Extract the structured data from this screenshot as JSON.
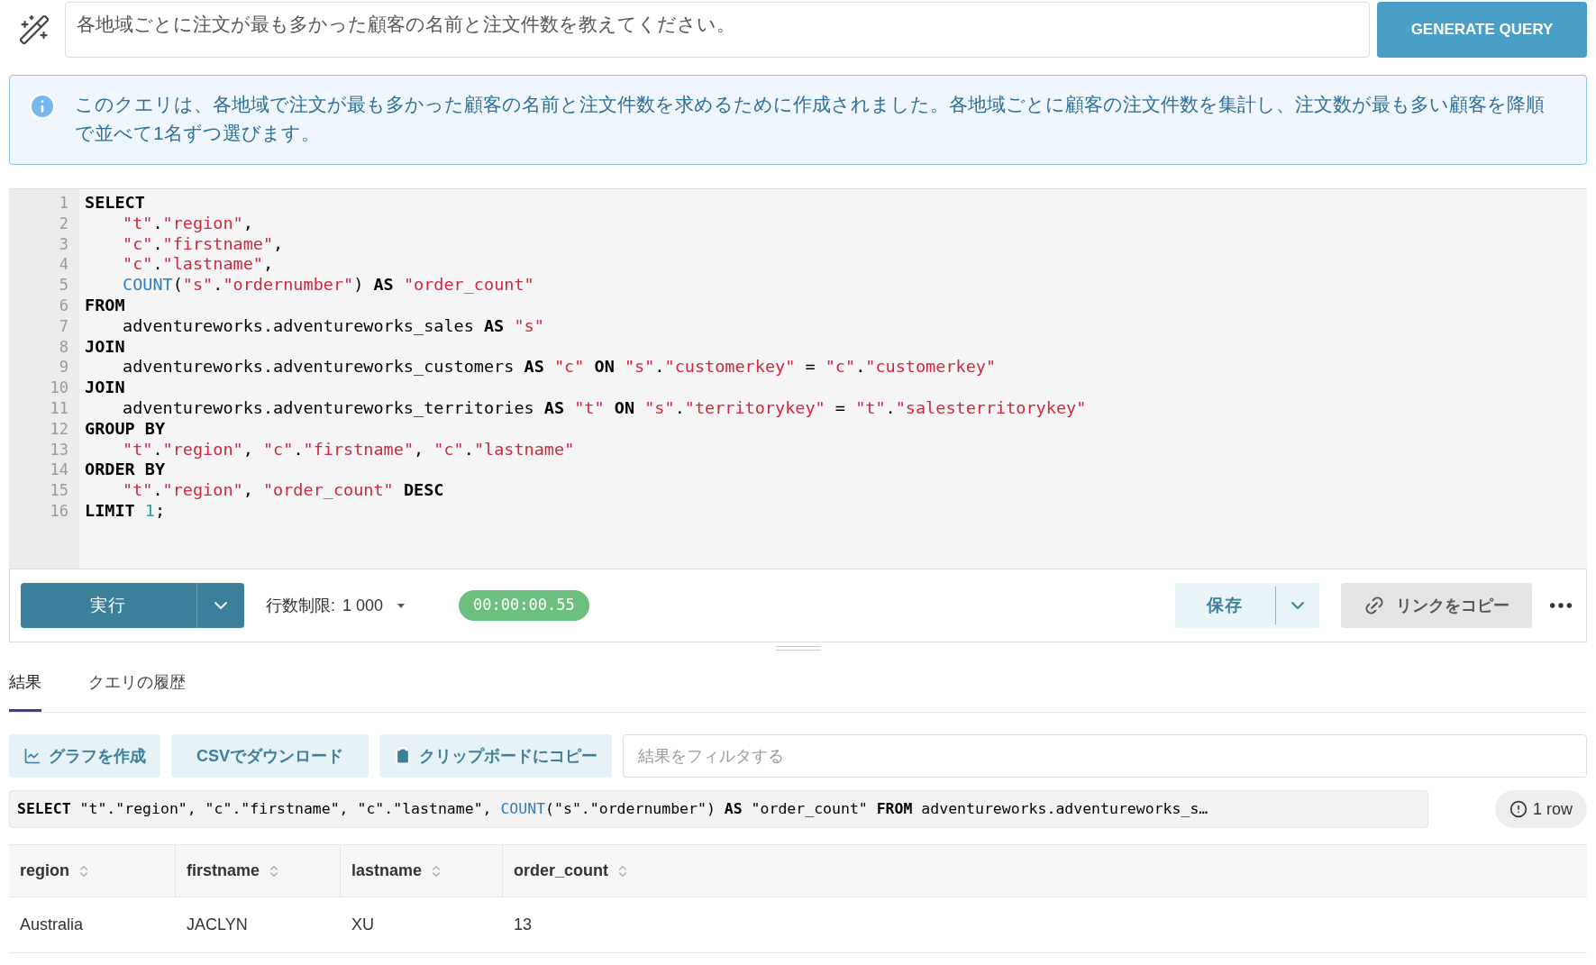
{
  "prompt": {
    "value": "各地域ごとに注文が最も多かった顧客の名前と注文件数を教えてください。",
    "button": "GENERATE QUERY"
  },
  "info": "このクエリは、各地域で注文が最も多かった顧客の名前と注文件数を求めるために作成されました。各地域ごとに顧客の注文件数を集計し、注文数が最も多い顧客を降順で並べて1名ずつ選びます。",
  "editor": {
    "lines": [
      {
        "number": "1",
        "indent": false,
        "tokens": [
          {
            "kind": "kw",
            "text": "SELECT"
          }
        ]
      },
      {
        "number": "2",
        "indent": true,
        "tokens": [
          {
            "kind": "str",
            "text": "\"t\""
          },
          {
            "kind": "plain",
            "text": "."
          },
          {
            "kind": "str",
            "text": "\"region\""
          },
          {
            "kind": "plain",
            "text": ","
          }
        ]
      },
      {
        "number": "3",
        "indent": true,
        "tokens": [
          {
            "kind": "str",
            "text": "\"c\""
          },
          {
            "kind": "plain",
            "text": "."
          },
          {
            "kind": "str",
            "text": "\"firstname\""
          },
          {
            "kind": "plain",
            "text": ","
          }
        ]
      },
      {
        "number": "4",
        "indent": true,
        "tokens": [
          {
            "kind": "str",
            "text": "\"c\""
          },
          {
            "kind": "plain",
            "text": "."
          },
          {
            "kind": "str",
            "text": "\"lastname\""
          },
          {
            "kind": "plain",
            "text": ","
          }
        ]
      },
      {
        "number": "5",
        "indent": true,
        "tokens": [
          {
            "kind": "fn",
            "text": "COUNT"
          },
          {
            "kind": "plain",
            "text": "("
          },
          {
            "kind": "str",
            "text": "\"s\""
          },
          {
            "kind": "plain",
            "text": "."
          },
          {
            "kind": "str",
            "text": "\"ordernumber\""
          },
          {
            "kind": "plain",
            "text": ") "
          },
          {
            "kind": "kw",
            "text": "AS"
          },
          {
            "kind": "str",
            "text": " \"order_count\""
          }
        ]
      },
      {
        "number": "6",
        "indent": false,
        "tokens": [
          {
            "kind": "kw",
            "text": "FROM"
          }
        ]
      },
      {
        "number": "7",
        "indent": true,
        "tokens": [
          {
            "kind": "plain",
            "text": "adventureworks.adventureworks_sales "
          },
          {
            "kind": "kw",
            "text": "AS"
          },
          {
            "kind": "str",
            "text": " \"s\""
          }
        ]
      },
      {
        "number": "8",
        "indent": false,
        "tokens": [
          {
            "kind": "kw",
            "text": "JOIN"
          }
        ]
      },
      {
        "number": "9",
        "indent": true,
        "tokens": [
          {
            "kind": "plain",
            "text": "adventureworks.adventureworks_customers "
          },
          {
            "kind": "kw",
            "text": "AS"
          },
          {
            "kind": "str",
            "text": " \"c\" "
          },
          {
            "kind": "kw",
            "text": "ON"
          },
          {
            "kind": "str",
            "text": " \"s\""
          },
          {
            "kind": "plain",
            "text": "."
          },
          {
            "kind": "str",
            "text": "\"customerkey\""
          },
          {
            "kind": "plain",
            "text": " = "
          },
          {
            "kind": "str",
            "text": "\"c\""
          },
          {
            "kind": "plain",
            "text": "."
          },
          {
            "kind": "str",
            "text": "\"customerkey\""
          }
        ]
      },
      {
        "number": "10",
        "indent": false,
        "tokens": [
          {
            "kind": "kw",
            "text": "JOIN"
          }
        ]
      },
      {
        "number": "11",
        "indent": true,
        "tokens": [
          {
            "kind": "plain",
            "text": "adventureworks.adventureworks_territories "
          },
          {
            "kind": "kw",
            "text": "AS"
          },
          {
            "kind": "str",
            "text": " \"t\" "
          },
          {
            "kind": "kw",
            "text": "ON"
          },
          {
            "kind": "str",
            "text": " \"s\""
          },
          {
            "kind": "plain",
            "text": "."
          },
          {
            "kind": "str",
            "text": "\"territorykey\""
          },
          {
            "kind": "plain",
            "text": " = "
          },
          {
            "kind": "str",
            "text": "\"t\""
          },
          {
            "kind": "plain",
            "text": "."
          },
          {
            "kind": "str",
            "text": "\"salesterritorykey\""
          }
        ]
      },
      {
        "number": "12",
        "indent": false,
        "tokens": [
          {
            "kind": "kw",
            "text": "GROUP BY"
          }
        ]
      },
      {
        "number": "13",
        "indent": true,
        "tokens": [
          {
            "kind": "str",
            "text": "\"t\""
          },
          {
            "kind": "plain",
            "text": "."
          },
          {
            "kind": "str",
            "text": "\"region\""
          },
          {
            "kind": "plain",
            "text": ", "
          },
          {
            "kind": "str",
            "text": "\"c\""
          },
          {
            "kind": "plain",
            "text": "."
          },
          {
            "kind": "str",
            "text": "\"firstname\""
          },
          {
            "kind": "plain",
            "text": ", "
          },
          {
            "kind": "str",
            "text": "\"c\""
          },
          {
            "kind": "plain",
            "text": "."
          },
          {
            "kind": "str",
            "text": "\"lastname\""
          }
        ]
      },
      {
        "number": "14",
        "indent": false,
        "tokens": [
          {
            "kind": "kw",
            "text": "ORDER BY"
          }
        ]
      },
      {
        "number": "15",
        "indent": true,
        "tokens": [
          {
            "kind": "str",
            "text": "\"t\""
          },
          {
            "kind": "plain",
            "text": "."
          },
          {
            "kind": "str",
            "text": "\"region\""
          },
          {
            "kind": "plain",
            "text": ", "
          },
          {
            "kind": "str",
            "text": "\"order_count\" "
          },
          {
            "kind": "kw",
            "text": "DESC"
          }
        ]
      },
      {
        "number": "16",
        "indent": false,
        "tokens": [
          {
            "kind": "kw",
            "text": "LIMIT "
          },
          {
            "kind": "num",
            "text": "1"
          },
          {
            "kind": "plain",
            "text": ";"
          }
        ]
      }
    ]
  },
  "toolbar": {
    "run": "実行",
    "row_limit_label": "行数制限:",
    "row_limit_value": "1 000",
    "timer": "00:00:00.55",
    "save": "保存",
    "copy_link": "リンクをコピー"
  },
  "tabs": [
    {
      "label": "結果",
      "selected": true
    },
    {
      "label": "クエリの履歴",
      "selected": false
    }
  ],
  "actions": [
    "グラフを作成",
    "CSVでダウンロード",
    "クリップボードにコピー"
  ],
  "filter": {
    "placeholder": "結果をフィルタする"
  },
  "summary": {
    "tokens": [
      {
        "kind": "kw",
        "text": "SELECT"
      },
      {
        "kind": "plain",
        "text": " \"t\".\"region\", \"c\".\"firstname\", \"c\".\"lastname\", "
      },
      {
        "kind": "fn",
        "text": "COUNT"
      },
      {
        "kind": "plain",
        "text": "(\"s\".\"ordernumber\") "
      },
      {
        "kind": "kw",
        "text": "AS"
      },
      {
        "kind": "plain",
        "text": " \"order_count\" "
      },
      {
        "kind": "kw",
        "text": "FROM"
      },
      {
        "kind": "plain",
        "text": " adventureworks.adventureworks_s…"
      }
    ],
    "row_count": "1 row"
  },
  "table": {
    "columns": [
      "region",
      "firstname",
      "lastname",
      "order_count"
    ],
    "rows": [
      [
        "Australia",
        "JACLYN",
        "XU",
        "13"
      ]
    ]
  }
}
